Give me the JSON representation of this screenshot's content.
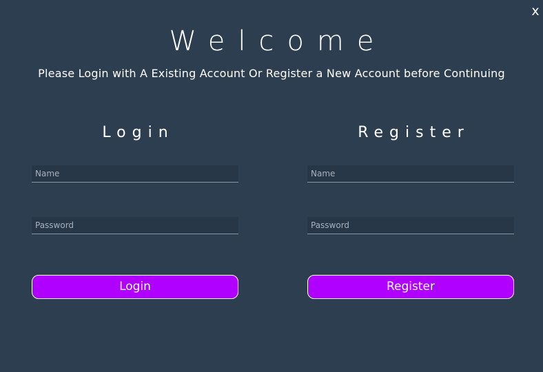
{
  "window": {
    "close_label": "x"
  },
  "header": {
    "title": "Welcome",
    "subtitle": "Please Login with A Existing Account Or Register a New Account before Continuing"
  },
  "login": {
    "heading": "Login",
    "name_placeholder": "Name",
    "password_placeholder": "Password",
    "button_label": "Login"
  },
  "register": {
    "heading": "Register",
    "name_placeholder": "Name",
    "password_placeholder": "Password",
    "button_label": "Register"
  },
  "colors": {
    "background": "#2e3e51",
    "input_background": "#283747",
    "accent": "#b000ff",
    "text": "#ffffff"
  }
}
